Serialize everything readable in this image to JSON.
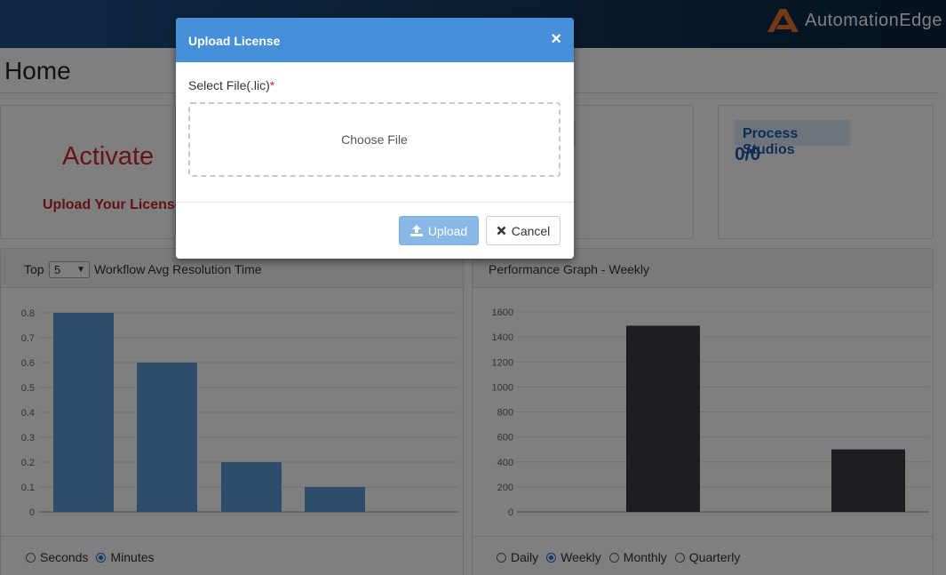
{
  "header": {
    "logo_text": "AutomationEdge"
  },
  "page": {
    "title": "Home"
  },
  "cards": {
    "activate": {
      "title": "Activate",
      "link": "Upload Your License"
    },
    "process_studios": {
      "label": "Process Studios",
      "count": "0/0"
    }
  },
  "left_panel": {
    "prefix": "Top",
    "top_select_value": "5",
    "title": "Workflow Avg Resolution Time",
    "radios": [
      {
        "label": "Seconds",
        "checked": false
      },
      {
        "label": "Minutes",
        "checked": true
      }
    ]
  },
  "right_panel": {
    "title": "Performance Graph - Weekly",
    "radios": [
      {
        "label": "Daily",
        "checked": false
      },
      {
        "label": "Weekly",
        "checked": true
      },
      {
        "label": "Monthly",
        "checked": false
      },
      {
        "label": "Quarterly",
        "checked": false
      }
    ]
  },
  "modal": {
    "title": "Upload License",
    "close_glyph": "×",
    "field_label": "Select File(.lic)",
    "required_mark": "*",
    "dropzone_text": "Choose File",
    "upload_label": "Upload",
    "cancel_label": "Cancel"
  },
  "colors": {
    "left_bar": "#5b9bd5",
    "right_bar": "#3d3d44",
    "accent": "#4590d8",
    "danger": "#d0282f"
  },
  "chart_data": [
    {
      "type": "bar",
      "categories": [
        "",
        "",
        "",
        ""
      ],
      "values": [
        0.8,
        0.6,
        0.2,
        0.1
      ],
      "ylim": [
        0,
        0.8
      ],
      "yticks": [
        0,
        0.1,
        0.2,
        0.3,
        0.4,
        0.5,
        0.6,
        0.7,
        0.8
      ],
      "ytick_labels": [
        "0",
        "0.1",
        "0.2",
        "0.3",
        "0.4",
        "0.5",
        "0.6",
        "0.7",
        "0.8"
      ],
      "grid": true
    },
    {
      "type": "bar",
      "categories": [
        "",
        ""
      ],
      "values": [
        1490,
        500
      ],
      "ylim": [
        0,
        1600
      ],
      "yticks": [
        0,
        200,
        400,
        600,
        800,
        1000,
        1200,
        1400,
        1600
      ],
      "ytick_labels": [
        "0",
        "200",
        "400",
        "600",
        "800",
        "1000",
        "1200",
        "1400",
        "1600"
      ],
      "grid": true
    }
  ]
}
